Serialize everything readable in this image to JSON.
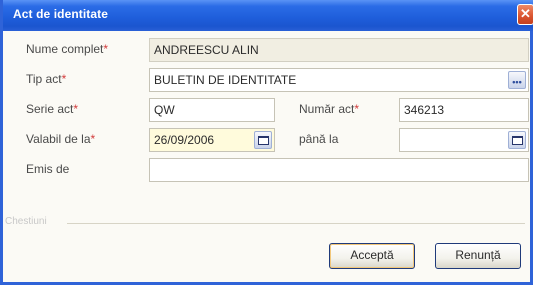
{
  "dialog": {
    "title": "Act de identitate",
    "close_symbol": "✕"
  },
  "form": {
    "full_name": {
      "label": "Nume complet",
      "value": "ANDREESCU ALIN"
    },
    "doc_type": {
      "label": "Tip act",
      "value": "BULETIN DE IDENTITATE",
      "button_icon": "ellipsis-icon"
    },
    "series": {
      "label": "Serie act",
      "value": "QW"
    },
    "number": {
      "label": "Număr act",
      "value": "346213"
    },
    "valid_from": {
      "label": "Valabil de la",
      "value": "26/09/2006",
      "button_icon": "calendar-icon"
    },
    "valid_to": {
      "label": "până la",
      "value": "",
      "button_icon": "calendar-icon"
    },
    "issued_by": {
      "label": "Emis de",
      "value": ""
    },
    "required_mark": "*",
    "group_legend": "Chestiuni"
  },
  "buttons": {
    "accept": "Acceptă",
    "cancel": "Renunță"
  },
  "colors": {
    "title_bar": "#1f5fdc",
    "required": "#d23a3a",
    "close_button": "#d9532f"
  }
}
